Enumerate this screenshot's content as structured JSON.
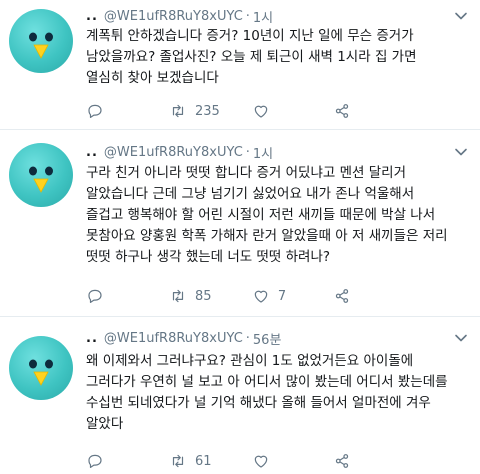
{
  "tweets": [
    {
      "display_name": "..",
      "handle": "@WE1ufR8RuY8xUYC",
      "separator": "·",
      "time": "1시",
      "lines": [
        "계폭튀 안하겠습니다 증거? 10년이 지난 일에 무슨 증거가",
        "남았을까요? 졸업사진? 오늘 제 퇴근이 새벽 1시라 집 가면",
        "열심히 찾아 보겠습니다"
      ],
      "replies": "",
      "retweets": "235",
      "likes": "",
      "share": ""
    },
    {
      "display_name": "..",
      "handle": "@WE1ufR8RuY8xUYC",
      "separator": "·",
      "time": "1시",
      "lines": [
        "구라 친거 아니라 떳떳 합니다 증거 어딨냐고 멘션 달리거",
        "알았습니다 근데 그냥 넘기기 싫었어요 내가 존나 억울해서",
        "즐겁고 행복해야 할 어린 시절이 저런 새끼들 때문에 박살 나서",
        "못참아요 양홍원 학폭 가해자 란거 알았을때 아 저 새끼들은 저리",
        "떳떳 하구나 생각 했는데 너도 떳떳 하려나?"
      ],
      "replies": "",
      "retweets": "85",
      "likes": "7",
      "share": ""
    },
    {
      "display_name": "..",
      "handle": "@WE1ufR8RuY8xUYC",
      "separator": "·",
      "time": "56분",
      "lines": [
        "왜 이제와서 그러냐구요? 관심이 1도 없었거든요 아이돌에",
        "그러다가 우연히 널 보고 아 어디서 많이 봤는데 어디서 봤는데를",
        "수십번 되네였다가 널 기억 해냈다 올해 들어서 얼마전에 겨우",
        "알았다"
      ],
      "replies": "",
      "retweets": "61",
      "likes": "",
      "share": ""
    }
  ],
  "colors": {
    "avatar": "#3fc4c2",
    "bird": "#ffd21f",
    "meta": "#657786",
    "text": "#14171a"
  }
}
